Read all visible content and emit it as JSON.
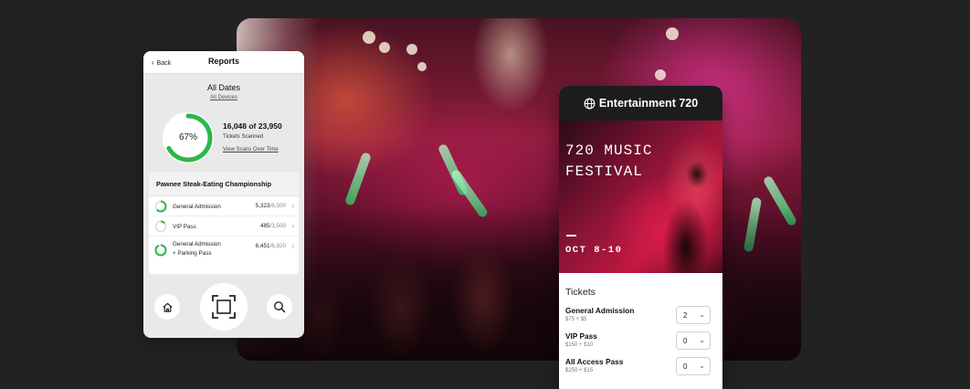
{
  "reports": {
    "back_label": "Back",
    "title": "Reports",
    "date_range": "All Dates",
    "devices_link": "All Devices",
    "percent_label": "67%",
    "percent_value": 0.67,
    "scanned_count": "16,048 of 23,950",
    "scanned_sub": "Tickets Scanned",
    "scans_link": "View Scans Over Time",
    "event_name": "Pawnee Steak-Eating Championship",
    "rows": [
      {
        "name": "General Admission",
        "count": "5,323",
        "total": "/8,500",
        "fraction": 0.63
      },
      {
        "name": "VIP Pass",
        "count": "485",
        "total": "/3,500",
        "fraction": 0.14
      },
      {
        "name_line1": "General Admission",
        "name_line2": "+ Parking Pass",
        "count": "6,451",
        "total": "/6,920",
        "fraction": 0.93
      }
    ],
    "nav": {
      "home_icon": "home-icon",
      "scan_icon": "scan-icon",
      "search_icon": "search-icon"
    }
  },
  "ticket": {
    "brand": "Entertainment 720",
    "event_title": "720 MUSIC\nFESTIVAL",
    "event_date": "OCT 8-10",
    "section_label": "Tickets",
    "items": [
      {
        "name": "General Admission",
        "price": "$75 + $5",
        "qty": "2"
      },
      {
        "name": "VIP Pass",
        "price": "$150 + $10",
        "qty": "0"
      },
      {
        "name": "All Access Pass",
        "price": "$250 + $15",
        "qty": "0"
      }
    ]
  },
  "colors": {
    "background": "#222222",
    "progress_green": "#2db84a",
    "ticket_header": "#1c1c1c",
    "hero_red": "#c0183f"
  }
}
